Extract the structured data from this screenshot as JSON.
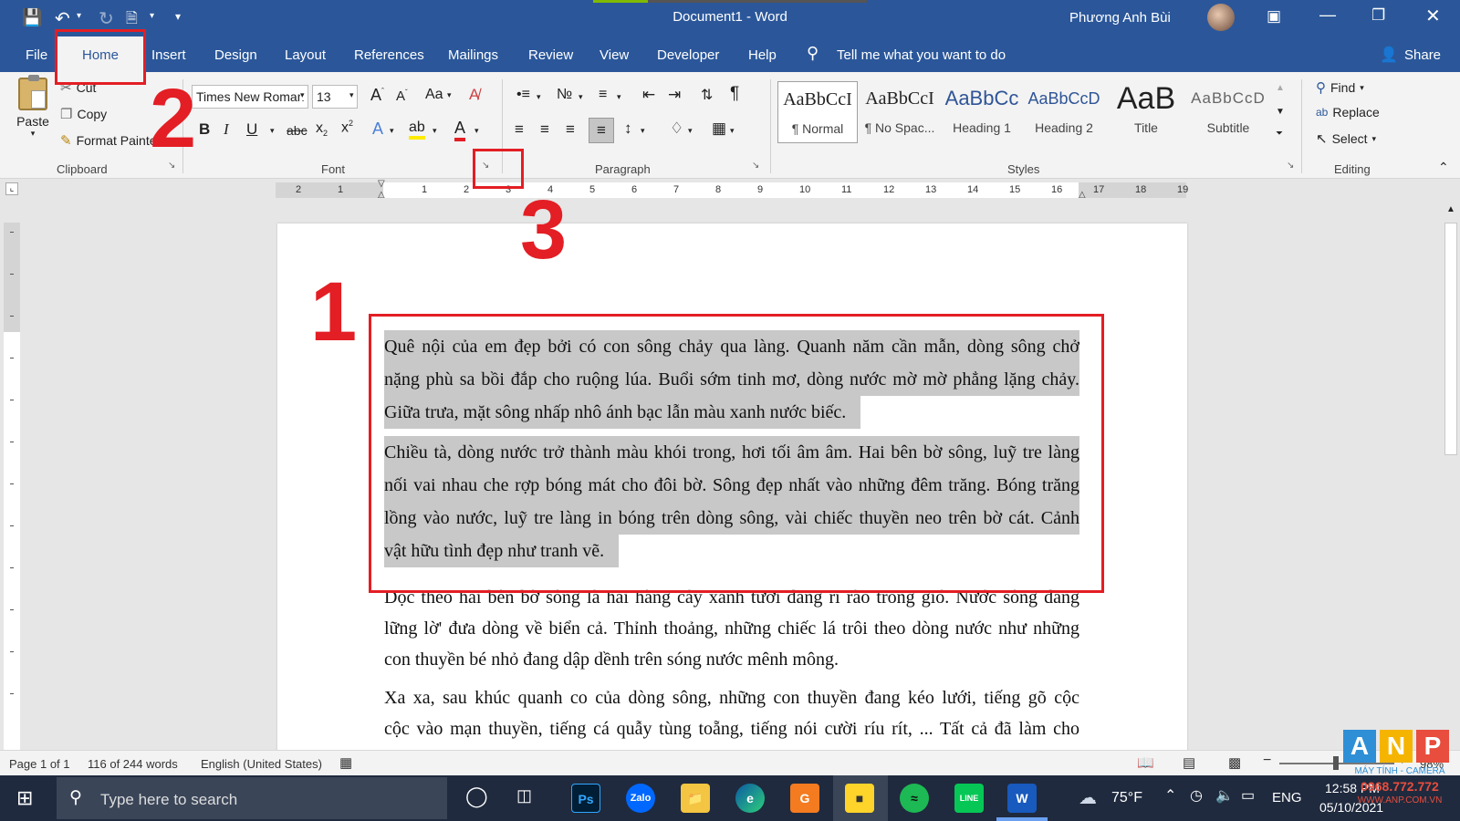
{
  "window": {
    "title": "Document1 - Word",
    "user": "Phương Anh Bùi"
  },
  "quick_access": {
    "save": "save-icon",
    "undo": "undo-icon",
    "redo": "redo-icon",
    "customize": "customize-icon"
  },
  "menu": {
    "file": "File",
    "home": "Home",
    "insert": "Insert",
    "design": "Design",
    "layout": "Layout",
    "references": "References",
    "mailings": "Mailings",
    "review": "Review",
    "view": "View",
    "developer": "Developer",
    "help": "Help",
    "tell_me": "Tell me what you want to do",
    "share": "Share"
  },
  "ribbon": {
    "clipboard": {
      "paste": "Paste",
      "cut": "Cut",
      "copy": "Copy",
      "format_painter": "Format Painter",
      "label": "Clipboard"
    },
    "font": {
      "font_name": "Times New Roman",
      "font_size": "13",
      "label": "Font",
      "case": "Aa"
    },
    "paragraph": {
      "label": "Paragraph"
    },
    "styles": {
      "label": "Styles",
      "items": [
        {
          "preview": "AaBbCcI",
          "name": "¶ Normal"
        },
        {
          "preview": "AaBbCcI",
          "name": "¶ No Spac..."
        },
        {
          "preview": "AaBbCc",
          "name": "Heading 1"
        },
        {
          "preview": "AaBbCcD",
          "name": "Heading 2"
        },
        {
          "preview": "AaB",
          "name": "Title"
        },
        {
          "preview": "AaBbCcD",
          "name": "Subtitle"
        }
      ]
    },
    "editing": {
      "find": "Find",
      "replace": "Replace",
      "select": "Select",
      "label": "Editing"
    }
  },
  "ruler": {
    "ticks": [
      "2",
      "1",
      "1",
      "2",
      "3",
      "4",
      "5",
      "6",
      "7",
      "8",
      "9",
      "10",
      "11",
      "12",
      "13",
      "14",
      "15",
      "16",
      "17",
      "18",
      "19"
    ]
  },
  "document": {
    "paragraphs": [
      {
        "lines": [
          "Quê nội của em đẹp bởi có con sông chảy qua làng. Quanh năm cần mẫn, dòng sông chở",
          "nặng phù sa bồi đắp cho ruộng lúa. Buổi sớm tinh mơ, dòng nước mờ mờ phẳng lặng chảy.",
          "Giữa trưa, mặt sông nhấp nhô ánh bạc lẫn màu xanh nước biếc."
        ]
      },
      {
        "lines": [
          "Chiều tà, dòng nước trở thành màu khói trong, hơi tối âm âm. Hai bên bờ sông, luỹ tre làng",
          "nối vai nhau che rợp bóng mát cho đôi bờ. Sông đẹp nhất vào những đêm trăng. Bóng trăng",
          "lồng vào nước, luỹ tre làng in bóng trên dòng sông, vài chiếc thuyền neo trên bờ cát. Cảnh",
          "vật hữu tình đẹp như tranh vẽ."
        ]
      },
      {
        "lines": [
          "Dọc theo hai bên bờ sông là hai hàng cây xanh tươi đang rì rào trong gió. Nước sông đang",
          "lững lờ' đưa dòng về biển cả. Thỉnh thoảng, những chiếc lá trôi theo dòng nước như những",
          "con thuyền bé nhỏ đang dập dềnh trên sóng nước mênh mông."
        ]
      },
      {
        "lines": [
          "Xa xa, sau khúc quanh co của dòng sông, những con thuyền đang kéo lưới, tiếng gõ cộc",
          "cộc vào mạn thuyền, tiếng cá quẫy tùng toẵng, tiếng nói cười ríu rít, ... Tất cả đã làm cho"
        ]
      }
    ]
  },
  "annotations": {
    "one": "1",
    "two": "2",
    "three": "3"
  },
  "status": {
    "page": "Page 1 of 1",
    "words": "116 of 244 words",
    "language": "English (United States)",
    "zoom": "98%"
  },
  "taskbar": {
    "search_placeholder": "Type here to search",
    "weather": "75°F",
    "lang": "ENG",
    "time": "12:58 PM",
    "date": "05/10/2021"
  },
  "watermark": {
    "brand": "ANP",
    "line1": "MÁY TÍNH - CAMERA",
    "line2": "0968.772.772",
    "line3": "WWW.ANP.COM.VN"
  },
  "colors": {
    "word_blue": "#2b579a",
    "annotation_red": "#e31e24",
    "selection_gray": "#c8c8c8"
  }
}
